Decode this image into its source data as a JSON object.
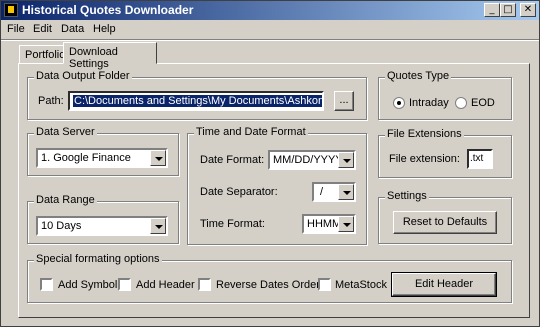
{
  "window": {
    "title": "Historical Quotes Downloader",
    "controls": {
      "minimize": "_",
      "maximize": "□",
      "close": "✕"
    }
  },
  "menu": [
    "File",
    "Edit",
    "Data",
    "Help"
  ],
  "tabs": {
    "portfolio": "Portfolio",
    "download_settings": "Download Settings"
  },
  "data_output_folder": {
    "legend": "Data Output Folder",
    "path_label": "Path:",
    "path_value": "C:\\Documents and Settings\\My Documents\\Ashkon Techn",
    "browse_label": "..."
  },
  "quotes_type": {
    "legend": "Quotes Type",
    "intraday": "Intraday",
    "eod": "EOD",
    "selected": "Intraday"
  },
  "data_server": {
    "legend": "Data Server",
    "value": "1. Google Finance"
  },
  "time_date_format": {
    "legend": "Time and Date Format",
    "date_format_label": "Date Format:",
    "date_format_value": "MM/DD/YYYY",
    "date_separator_label": "Date Separator:",
    "date_separator_value": "/",
    "time_format_label": "Time Format:",
    "time_format_value": "HHMM"
  },
  "file_extensions": {
    "legend": "File Extensions",
    "label": "File extension:",
    "value": ".txt"
  },
  "data_range": {
    "legend": "Data Range",
    "value": "10 Days"
  },
  "settings": {
    "legend": "Settings",
    "reset_label": "Reset to Defaults"
  },
  "special_formatting": {
    "legend": "Special formating options",
    "add_symbol": "Add Symbol",
    "add_header": "Add Header",
    "reverse_dates": "Reverse Dates Order",
    "metastock": "MetaStock",
    "edit_header": "Edit Header"
  }
}
